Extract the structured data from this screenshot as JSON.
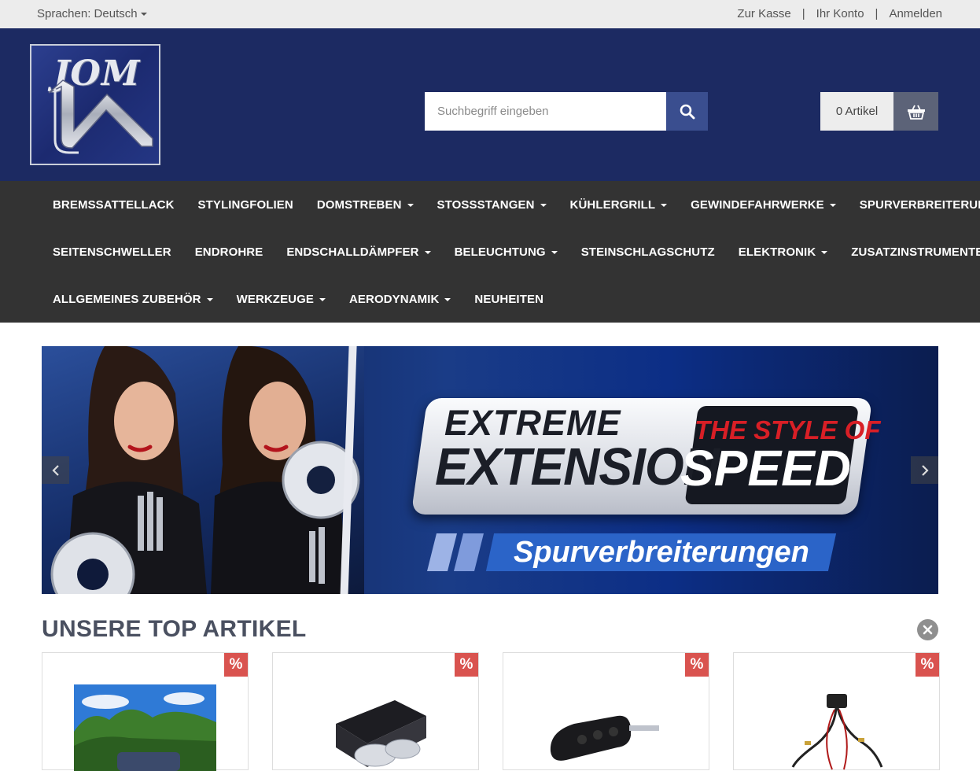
{
  "topbar": {
    "language_label": "Sprachen: Deutsch",
    "links": [
      "Zur Kasse",
      "Ihr Konto",
      "Anmelden"
    ],
    "separator": "|"
  },
  "header": {
    "logo_text": "JOM",
    "search_placeholder": "Suchbegriff eingeben",
    "cart_label": "0 Artikel"
  },
  "nav": {
    "rows": [
      [
        {
          "label": "BREMSSATTELLACK",
          "dropdown": false
        },
        {
          "label": "STYLINGFOLIEN",
          "dropdown": false
        },
        {
          "label": "DOMSTREBEN",
          "dropdown": true
        },
        {
          "label": "STOSSSTANGEN",
          "dropdown": true
        },
        {
          "label": "KÜHLERGRILL",
          "dropdown": true
        },
        {
          "label": "GEWINDEFAHRWERKE",
          "dropdown": true
        },
        {
          "label": "SPURVERBREITERUNG",
          "dropdown": true
        }
      ],
      [
        {
          "label": "SEITENSCHWELLER",
          "dropdown": false
        },
        {
          "label": "ENDROHRE",
          "dropdown": false
        },
        {
          "label": "ENDSCHALLDÄMPFER",
          "dropdown": true
        },
        {
          "label": "BELEUCHTUNG",
          "dropdown": true
        },
        {
          "label": "STEINSCHLAGSCHUTZ",
          "dropdown": false
        },
        {
          "label": "ELEKTRONIK",
          "dropdown": true
        },
        {
          "label": "ZUSATZINSTRUMENTE",
          "dropdown": true
        }
      ],
      [
        {
          "label": "ALLGEMEINES ZUBEHÖR",
          "dropdown": true
        },
        {
          "label": "WERKZEUGE",
          "dropdown": true
        },
        {
          "label": "AERODYNAMIK",
          "dropdown": true
        },
        {
          "label": "NEUHEITEN",
          "dropdown": false
        }
      ]
    ]
  },
  "banner": {
    "line1": "EXTREME",
    "line2": "EXTENSION",
    "line3": "THE STYLE OF",
    "line4": "SPEED",
    "subtitle": "Spurverbreiterungen",
    "prev_icon": "chevron-left-icon",
    "next_icon": "chevron-right-icon"
  },
  "section": {
    "title": "UNSERE TOP ARTIKEL",
    "close_icon": "close-icon"
  },
  "products": [
    {
      "badge": "%",
      "image": "car-photo"
    },
    {
      "badge": "%",
      "image": "wheel-spacers"
    },
    {
      "badge": "%",
      "image": "car-key"
    },
    {
      "badge": "%",
      "image": "wiring-harness"
    }
  ],
  "colors": {
    "header_bg": "#1c2a62",
    "nav_bg": "#333333",
    "search_button": "#3a4e8f",
    "cart_button": "#5c6378",
    "badge": "#d9534f"
  }
}
